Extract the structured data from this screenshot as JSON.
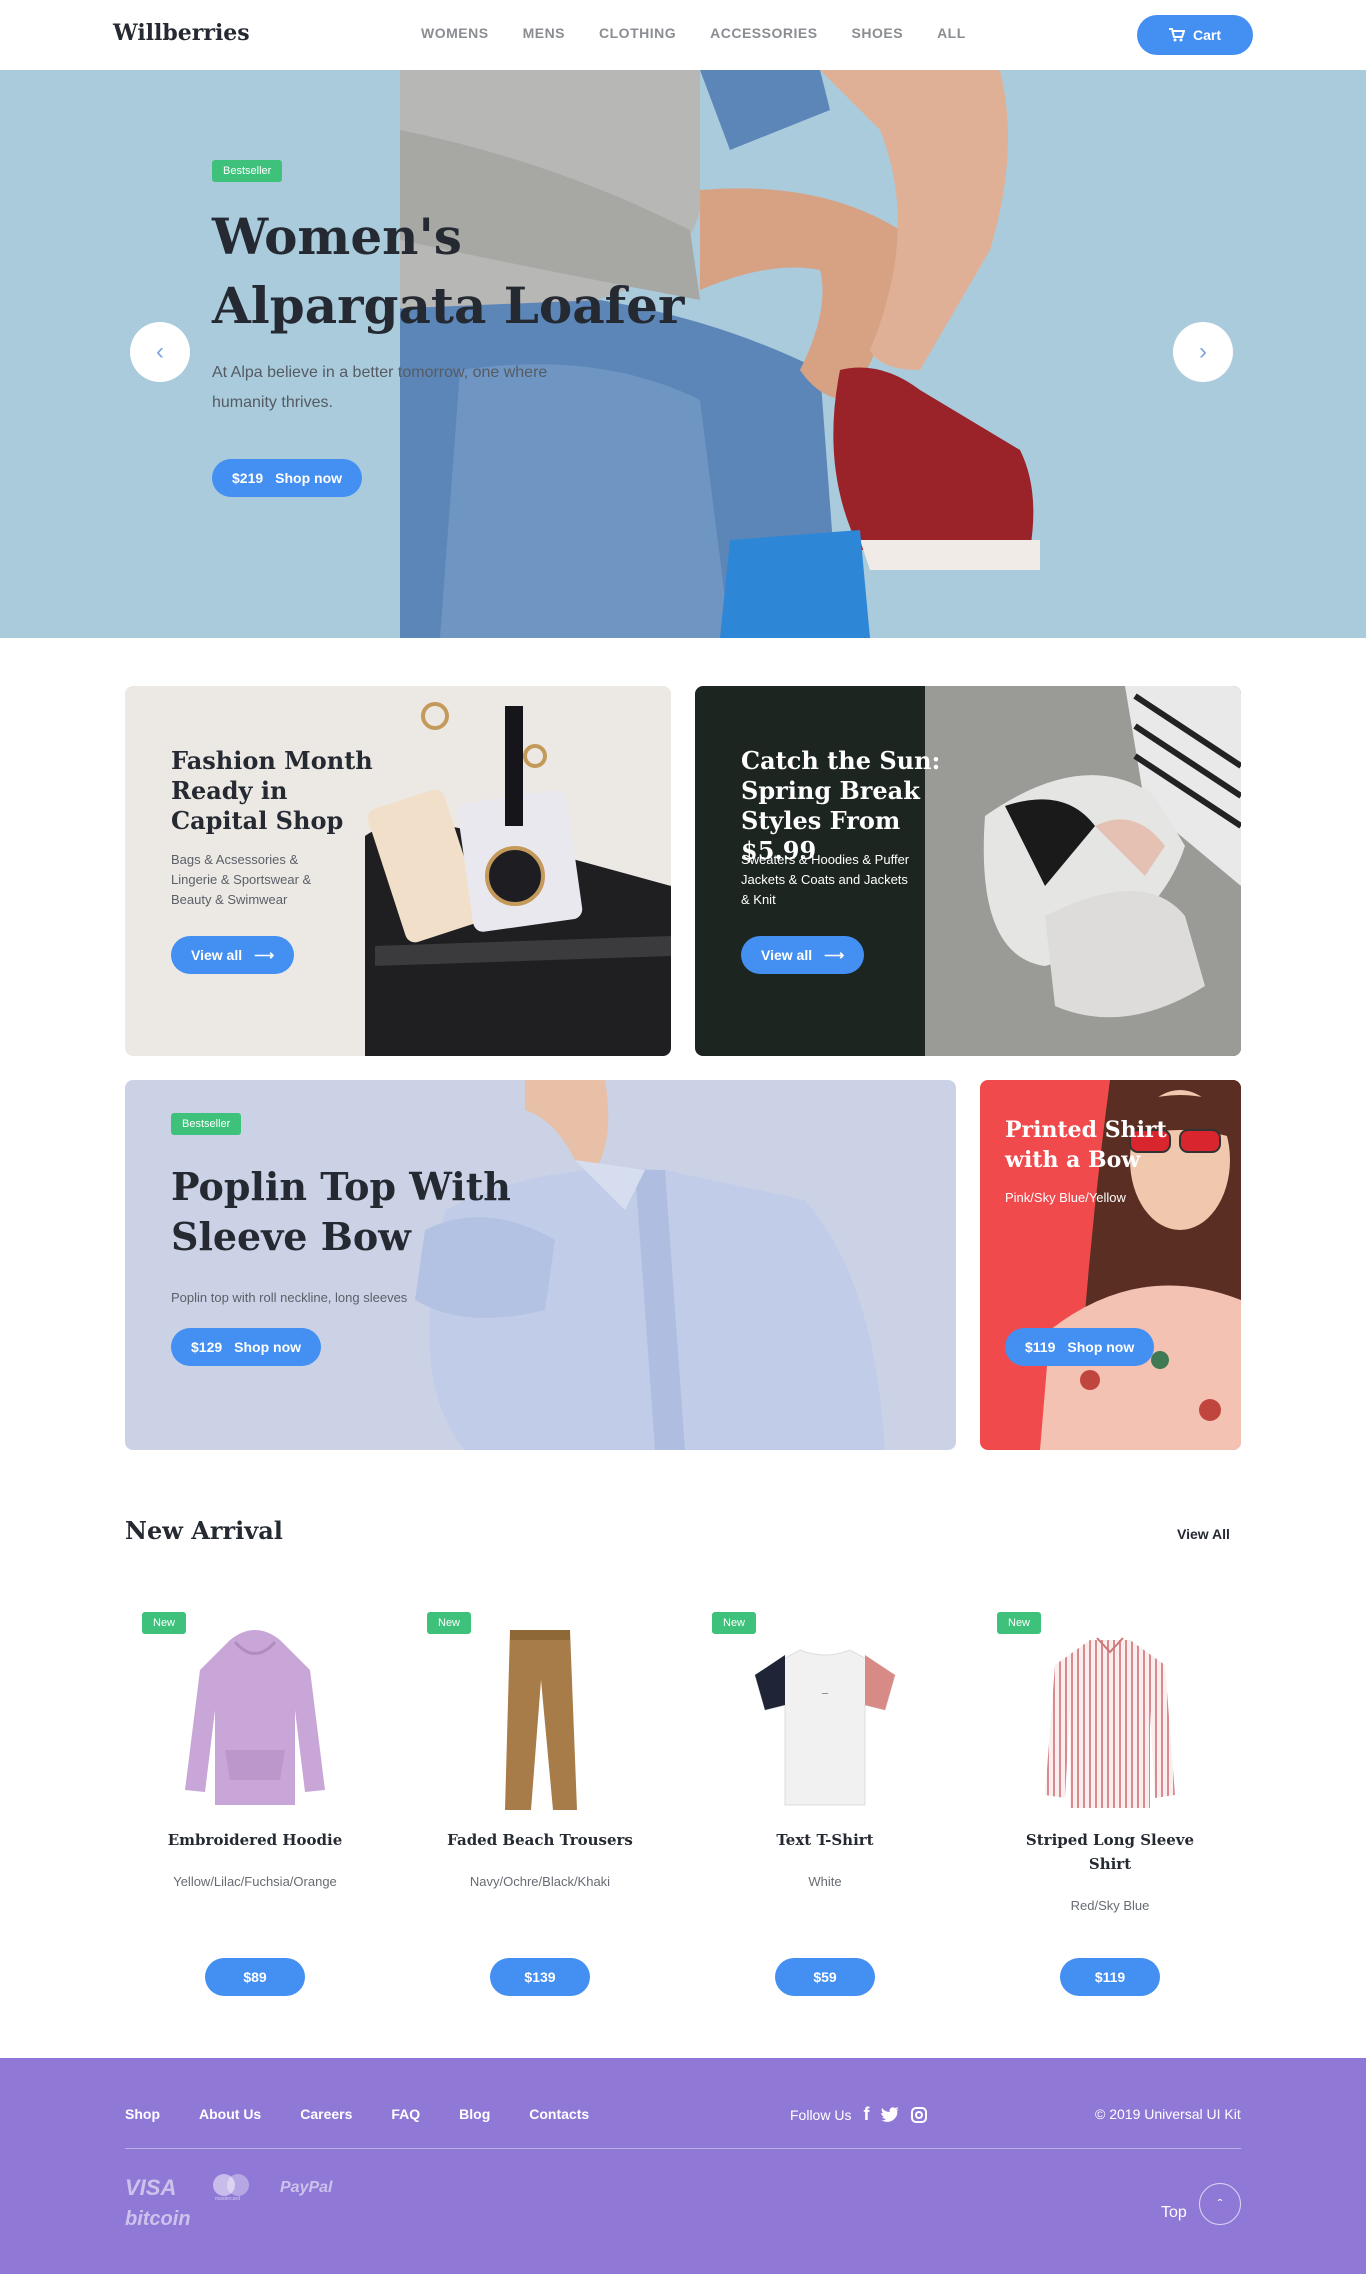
{
  "header": {
    "logo": "Willberries",
    "nav": [
      "WOMENS",
      "MENS",
      "CLOTHING",
      "ACCESSORIES",
      "SHOES",
      "ALL"
    ],
    "cart_label": "Cart",
    "cart_icon": "cart-icon"
  },
  "hero": {
    "badge": "Bestseller",
    "title": "Women's Alpargata Loafer",
    "description": "At Alpa believe in a better tomorrow, one where humanity thrives.",
    "price": "$219",
    "cta": "Shop now"
  },
  "promos": [
    {
      "title": "Fashion Month Ready in Capital Shop",
      "description": "Bags & Acsessories & Lingerie & Sportswear & Beauty & Swimwear",
      "cta": "View all"
    },
    {
      "title": "Catch the Sun: Spring Break Styles From $5.99",
      "description": "Sweaters & Hoodies & Puffer Jackets & Coats and Jackets & Knit",
      "cta": "View all"
    },
    {
      "badge": "Bestseller",
      "title": "Poplin Top With Sleeve Bow",
      "description": "Poplin top with roll neckline, long sleeves",
      "price": "$129",
      "cta": "Shop now"
    },
    {
      "title": "Printed Shirt with a Bow",
      "description": "Pink/Sky Blue/Yellow",
      "price": "$119",
      "cta": "Shop now"
    }
  ],
  "new_arrival": {
    "title": "New Arrival",
    "view_all": "View All",
    "products": [
      {
        "badge": "New",
        "name": "Embroidered Hoodie",
        "variants": "Yellow/Lilac/Fuchsia/Orange",
        "price": "$89"
      },
      {
        "badge": "New",
        "name": "Faded Beach Trousers",
        "variants": "Navy/Ochre/Black/Khaki",
        "price": "$139"
      },
      {
        "badge": "New",
        "name": "Text T-Shirt",
        "variants": "White",
        "price": "$59"
      },
      {
        "badge": "New",
        "name": "Striped Long Sleeve Shirt",
        "variants": "Red/Sky Blue",
        "price": "$119"
      }
    ]
  },
  "footer": {
    "links": [
      "Shop",
      "About Us",
      "Careers",
      "FAQ",
      "Blog",
      "Contacts"
    ],
    "follow_label": "Follow Us",
    "social": [
      "facebook-icon",
      "twitter-icon",
      "instagram-icon"
    ],
    "copyright": "© 2019 Universal UI Kit",
    "payments": [
      "VISA",
      "mastercard",
      "PayPal",
      "bitcoin"
    ],
    "top_label": "Top"
  },
  "colors": {
    "accent": "#438ff2",
    "badge": "#3ec17a",
    "footer": "#9078d6",
    "hero_bg": "#a9cbdc"
  }
}
